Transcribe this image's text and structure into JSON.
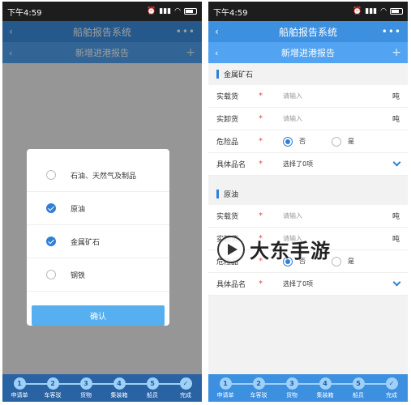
{
  "status_bar": {
    "time": "下午4:59"
  },
  "app_bar": {
    "title": "船舶报告系统",
    "more": "•••"
  },
  "sub_bar": {
    "title": "新增进港报告",
    "plus": "+"
  },
  "modal": {
    "options": [
      {
        "label": "石油、天然气及制品",
        "checked": false
      },
      {
        "label": "原油",
        "checked": true
      },
      {
        "label": "金属矿石",
        "checked": true
      },
      {
        "label": "钢铁",
        "checked": false
      }
    ],
    "confirm_label": "确认"
  },
  "form": {
    "sections": [
      {
        "title": "金属矿石",
        "rows": {
          "loaded": {
            "label": "实载货",
            "required": "*",
            "placeholder": "请输入",
            "unit": "吨"
          },
          "unloaded": {
            "label": "实卸货",
            "required": "*",
            "placeholder": "请输入",
            "unit": "吨"
          },
          "dangerous": {
            "label": "危险品",
            "required": "*",
            "no": "否",
            "yes": "是",
            "selected": "否"
          },
          "product": {
            "label": "具体品名",
            "required": "*",
            "value": "选择了0项"
          }
        }
      },
      {
        "title": "原油",
        "rows": {
          "loaded": {
            "label": "实载货",
            "required": "*",
            "placeholder": "请输入",
            "unit": "吨"
          },
          "unloaded": {
            "label": "实卸货",
            "required": "*",
            "placeholder": "请输入",
            "unit": "吨"
          },
          "dangerous": {
            "label": "危险品",
            "required": "*",
            "no": "否",
            "yes": "是",
            "selected": "否"
          },
          "product": {
            "label": "具体品名",
            "required": "*",
            "value": "选择了0项"
          }
        }
      }
    ]
  },
  "progress": {
    "current_step": 6,
    "steps": [
      {
        "num": "1",
        "label": "申请单"
      },
      {
        "num": "2",
        "label": "车客驳"
      },
      {
        "num": "3",
        "label": "货物"
      },
      {
        "num": "4",
        "label": "集装箱"
      },
      {
        "num": "5",
        "label": "船员"
      },
      {
        "num": "✓",
        "label": "完成"
      }
    ]
  },
  "watermark": {
    "text": "大东手游"
  },
  "colors": {
    "primary": "#3d8fe0",
    "accent": "#2f7fd8",
    "required": "#e24a4a"
  }
}
